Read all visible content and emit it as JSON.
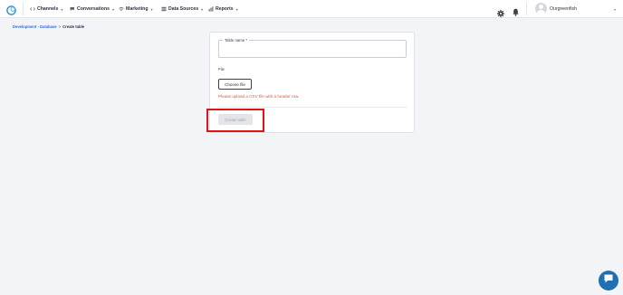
{
  "nav": {
    "items": [
      {
        "label": "Channels",
        "icon": "channels-icon"
      },
      {
        "label": "Conversations",
        "icon": "conversations-icon"
      },
      {
        "label": "Marketing",
        "icon": "marketing-icon"
      },
      {
        "label": "Data Sources",
        "icon": "data-sources-icon"
      },
      {
        "label": "Reports",
        "icon": "reports-icon"
      }
    ],
    "user": {
      "name": "Ourgreenfish"
    }
  },
  "breadcrumb": {
    "items": [
      "Development - Database",
      "Create table"
    ],
    "separator": ">"
  },
  "form": {
    "table_name_label": "Table name",
    "required_mark": "*",
    "table_name_value": "",
    "file_label": "File",
    "choose_file_label": "Choose file",
    "error_message": "Please upload a CSV file with a header row.",
    "create_button_label": "Create table"
  },
  "colors": {
    "accent": "#2f6fde",
    "error": "#e1574b",
    "highlight": "#e01414",
    "chat": "#1f6fb3"
  }
}
